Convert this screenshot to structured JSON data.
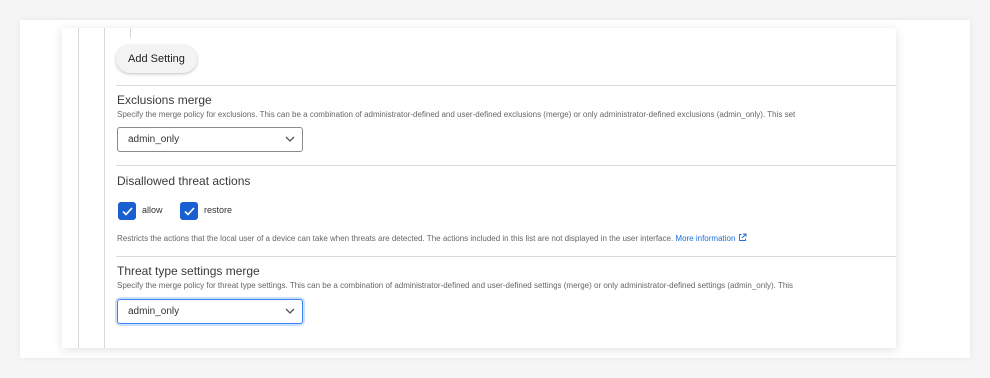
{
  "colors": {
    "accent": "#1a5fd1",
    "link": "#1f6fd6",
    "focus_ring": "#3b82f6"
  },
  "toolbar": {
    "add_setting_label": "Add Setting"
  },
  "exclusions_merge": {
    "title": "Exclusions merge",
    "description": "Specify the merge policy for exclusions. This can be a combination of administrator-defined and user-defined exclusions (merge) or only administrator-defined exclusions (admin_only). This set",
    "selected": "admin_only"
  },
  "disallowed_threat_actions": {
    "title": "Disallowed threat actions",
    "options": [
      {
        "label": "allow",
        "checked": true
      },
      {
        "label": "restore",
        "checked": true
      }
    ],
    "description": "Restricts the actions that the local user of a device can take when threats are detected. The actions included in this list are not displayed in the user interface.",
    "more_info_label": "More information"
  },
  "threat_type_settings_merge": {
    "title": "Threat type settings merge",
    "description": "Specify the merge policy for threat type settings. This can be a combination of administrator-defined and user-defined settings (merge) or only administrator-defined settings (admin_only). This",
    "selected": "admin_only"
  },
  "icons": {
    "chevron": "chevron-down-icon",
    "check": "checkmark-icon",
    "external": "external-link-icon"
  }
}
